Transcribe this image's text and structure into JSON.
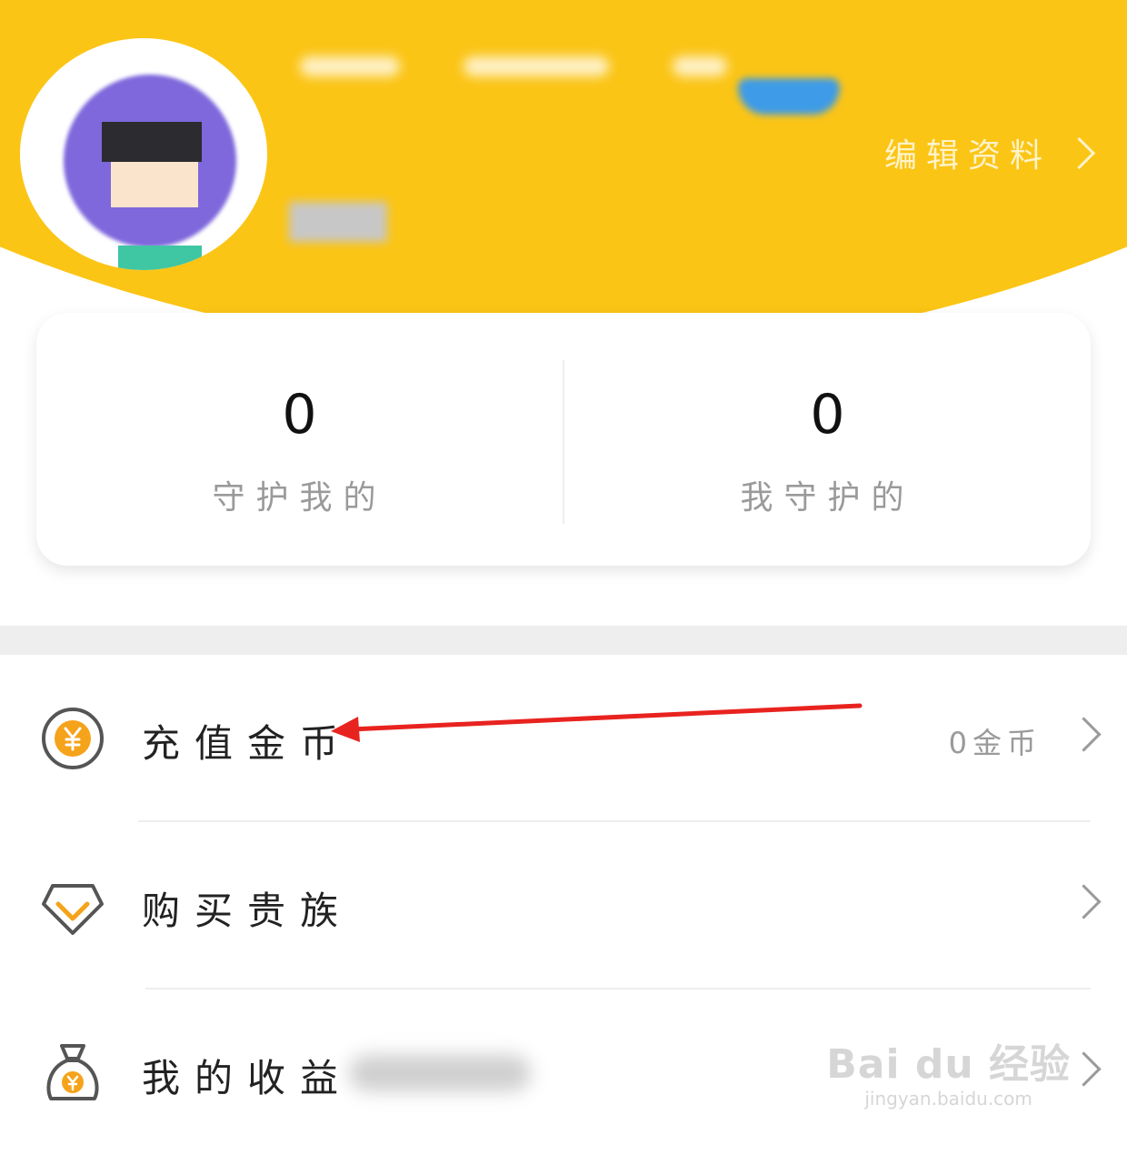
{
  "profile": {
    "edit_label": "编辑资料"
  },
  "stats": [
    {
      "value": "0",
      "label": "守护我的"
    },
    {
      "value": "0",
      "label": "我守护的"
    }
  ],
  "menu": [
    {
      "title": "充值金币",
      "value": "0金币",
      "icon": "yuan-coin-icon"
    },
    {
      "title": "购买贵族",
      "value": "",
      "icon": "diamond-icon"
    },
    {
      "title": "我的收益",
      "value": "",
      "icon": "money-bag-icon"
    }
  ],
  "watermark": {
    "logo": "Bai du 经验",
    "url": "jingyan.baidu.com"
  },
  "colors": {
    "header_yellow": "#FBC516",
    "icon_orange": "#F5A31A",
    "annotation_red": "#E8231F"
  }
}
